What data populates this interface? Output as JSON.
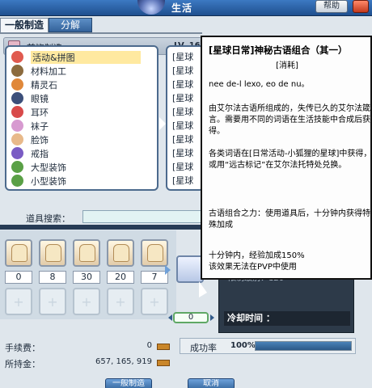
{
  "window": {
    "title": "生活",
    "help_label": "帮助"
  },
  "tabs": [
    {
      "label": "一般制造",
      "active": true
    },
    {
      "label": "分解",
      "active": false
    }
  ],
  "category_header": {
    "label": "首饰制造",
    "level": "LV. 16"
  },
  "categories": [
    {
      "label": "活动&拼图",
      "icon": "event-puzzle-icon",
      "color": "#e05a4f",
      "selected": true
    },
    {
      "label": "材料加工",
      "icon": "material-icon",
      "color": "#8c6b3e"
    },
    {
      "label": "精灵石",
      "icon": "spirit-stone-icon",
      "color": "#e0883a"
    },
    {
      "label": "眼镜",
      "icon": "glasses-icon",
      "color": "#3c4f7a"
    },
    {
      "label": "耳环",
      "icon": "earring-icon",
      "color": "#d84a4a"
    },
    {
      "label": "袜子",
      "icon": "socks-icon",
      "color": "#d79ad0"
    },
    {
      "label": "脸饰",
      "icon": "face-decoration-icon",
      "color": "#e8b98a"
    },
    {
      "label": "戒指",
      "icon": "ring-icon",
      "color": "#7a5cc4"
    },
    {
      "label": "大型装饰",
      "icon": "palm-tree-icon",
      "color": "#5aa046"
    },
    {
      "label": "小型装饰",
      "icon": "small-tree-icon",
      "color": "#5aa046"
    }
  ],
  "recipes": [
    "[星球",
    "[星球",
    "[星球",
    "[星球",
    "[星球",
    "[星球",
    "[星球",
    "[星球",
    "[星球",
    "[星球"
  ],
  "search": {
    "label": "道具搜索：",
    "placeholder": ""
  },
  "materials": [
    "0",
    "8",
    "30",
    "20",
    "7"
  ],
  "quantity": "0",
  "side": {
    "top_text": "限制级别：120",
    "cooldown_label": "冷却时间 ："
  },
  "fee": {
    "label": "手续费：",
    "value": "0"
  },
  "money": {
    "label": "所持金：",
    "value": "657, 165, 919"
  },
  "success_rate": {
    "label": "成功率",
    "value": "100%",
    "percent": 100
  },
  "buttons": {
    "left": "一般制造",
    "right": "取消"
  },
  "tooltip": {
    "title": "[星球日常]神秘古语组合（其一）",
    "subtitle": "[消耗]",
    "lines": [
      "nee de-l lexo, eo de nu。",
      "由艾尔法古语所组成的，失传已久的艾尔法箴言。需要用不同的词语在生活技能中合成后获得。",
      "  各类词语在[日常活动-小狐狸的星球]中获得，或用“远古标记”在艾尔法托特处兑换。",
      "古语组合之力：使用道具后，十分钟内获得特殊加成",
      "十分钟内，经验加成150%\n  该效果无法在PVP中使用"
    ]
  },
  "colors": {
    "title_bar": "#2a5fa3",
    "tab_active": "#f3f6f9",
    "selected_item": "#ffe9a0",
    "qty_border": "#5fa865"
  }
}
